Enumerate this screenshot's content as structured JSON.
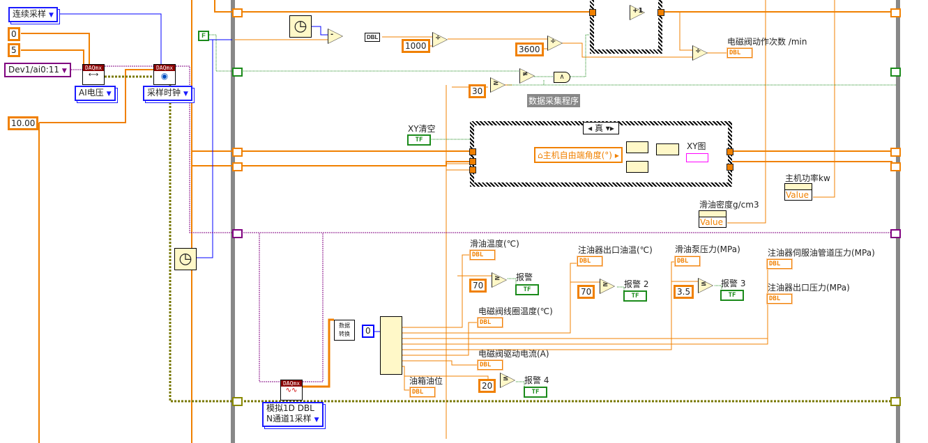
{
  "left": {
    "sample_mode": "连续采样",
    "min_value": "0",
    "max_value": "5",
    "channel": "Dev1/ai0:11",
    "create_channel_type": "AI电压",
    "timing_type": "采样时钟",
    "rate": "10.00",
    "daqmx_tag": "DAQmx"
  },
  "top": {
    "dbl_convert": "DBL",
    "const_1000": "1000",
    "const_3600": "3600",
    "increment": "+1",
    "count_label": "电磁阀动作次数 /min",
    "false_const": "F",
    "const_30": "30",
    "loop_label": "数据采集程序"
  },
  "case": {
    "selector": "真",
    "clear_label": "XY清空",
    "local_var": "主机自由端角度(°)",
    "graph_label": "XY图"
  },
  "props": {
    "power_label": "主机功率kw",
    "density_label": "滑油密度g/cm3",
    "value": "Value"
  },
  "bottom": {
    "convert_subvi": "数据\n转换",
    "index": "0",
    "read_type_line1": "模拟1D DBL",
    "read_type_line2": "N通道1采样",
    "indicators": [
      {
        "label": "滑油温度(℃)"
      },
      {
        "label": "电磁阀线圈温度(℃)"
      },
      {
        "label": "电磁阀驱动电流(A)"
      },
      {
        "label": "油箱油位"
      },
      {
        "label": "注油器出口油温(℃)"
      },
      {
        "label": "滑油泵压力(MPa)"
      },
      {
        "label": "注油器伺服油管道压力(MPa)"
      },
      {
        "label": "注油器出口压力(MPa)"
      }
    ],
    "alarms": [
      {
        "label": "报警",
        "threshold": "70"
      },
      {
        "label": "报警 2",
        "threshold": "70"
      },
      {
        "label": "报警 3",
        "threshold": "3.5"
      },
      {
        "label": "报警 4",
        "threshold": "20"
      }
    ]
  },
  "terminal_dbl": "DBL",
  "terminal_tf": "TF",
  "colors": {
    "double_wire": "#f08000",
    "boolean_wire": "#1a8a1a",
    "int_wire": "#0000ff",
    "task_wire": "#800080",
    "error_wire": "#cccc00",
    "loop_border": "#888888"
  }
}
